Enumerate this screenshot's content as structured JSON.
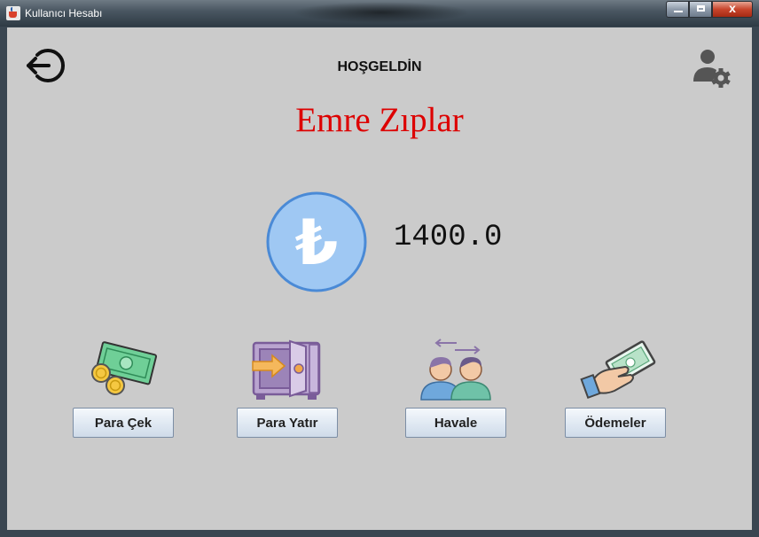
{
  "window": {
    "title": "Kullanıcı Hesabı",
    "controls": {
      "minimize": "",
      "maximize": "",
      "close": "x"
    }
  },
  "header": {
    "welcome": "HOŞGELDİN",
    "user_name": "Emre Zıplar",
    "logout_icon": "logout-icon",
    "settings_icon": "user-settings-icon"
  },
  "account": {
    "currency_icon": "turkish-lira-icon",
    "currency_symbol": "₺",
    "balance": "1400.0"
  },
  "actions": [
    {
      "label": "Para Çek",
      "icon": "money-withdraw-icon"
    },
    {
      "label": "Para Yatır",
      "icon": "safe-deposit-icon"
    },
    {
      "label": "Havale",
      "icon": "transfer-people-icon"
    },
    {
      "label": "Ödemeler",
      "icon": "payment-hand-icon"
    }
  ],
  "colors": {
    "background": "#cbcbcb",
    "name_red": "#dd0000",
    "coin_fill": "#9fc8f3",
    "coin_border": "#4a8ad6"
  }
}
